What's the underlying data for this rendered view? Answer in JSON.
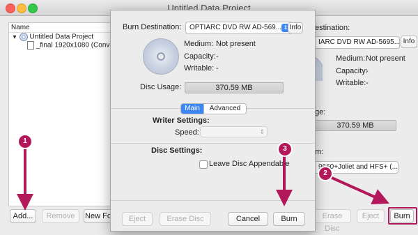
{
  "window": {
    "title": "Untitled Data Project"
  },
  "tree": {
    "header": "Name",
    "items": [
      {
        "label": "Untitled Data Project",
        "icon": "disc-icon"
      },
      {
        "label": "_final 1920x1080 (Conver",
        "icon": "file-icon"
      }
    ]
  },
  "bottom_bar": {
    "add": "Add...",
    "remove": "Remove",
    "new_folder": "New Fo",
    "erase_disc": "Erase Disc",
    "eject": "Eject",
    "burn": "Burn"
  },
  "right_panel": {
    "destination_suffix": "estination:",
    "drive": "IARC DVD RW AD-5695...",
    "info": "Info",
    "medium_label": "Medium:",
    "medium_value": "Not present",
    "capacity_label": "Capacity:",
    "capacity_value": "-",
    "writable_label": "Writable:",
    "writable_value": "-",
    "usage_partial": "ge:",
    "usage_value": "370.59 MB",
    "format_partial": "m:",
    "format_value": "9660+Joliet and HFS+ (..."
  },
  "sheet": {
    "burn_destination_label": "Burn Destination:",
    "drive": "OPTIARC DVD RW AD-569...",
    "info": "Info",
    "medium_label": "Medium:",
    "medium_value": "Not present",
    "capacity_label": "Capacity:",
    "capacity_value": "-",
    "writable_label": "Writable:",
    "writable_value": "-",
    "disc_usage_label": "Disc Usage:",
    "disc_usage_value": "370.59 MB",
    "tabs": [
      {
        "label": "Main",
        "selected": true
      },
      {
        "label": "Advanced",
        "selected": false
      }
    ],
    "writer_settings_label": "Writer Settings:",
    "speed_label": "Speed:",
    "speed_value": "",
    "disc_settings_label": "Disc Settings:",
    "leave_appendable_label": "Leave Disc Appendable",
    "leave_appendable_checked": false,
    "eject": "Eject",
    "erase_disc": "Erase Disc",
    "cancel": "Cancel",
    "burn": "Burn"
  },
  "annotations": {
    "step1": "1",
    "step2": "2",
    "step3": "3",
    "color": "#b3185a"
  },
  "colors": {
    "accent": "#3d87f5",
    "annotation": "#b3185a",
    "traffic_close": "#fc605c",
    "traffic_min": "#fdbc40",
    "traffic_max": "#34c84a"
  }
}
